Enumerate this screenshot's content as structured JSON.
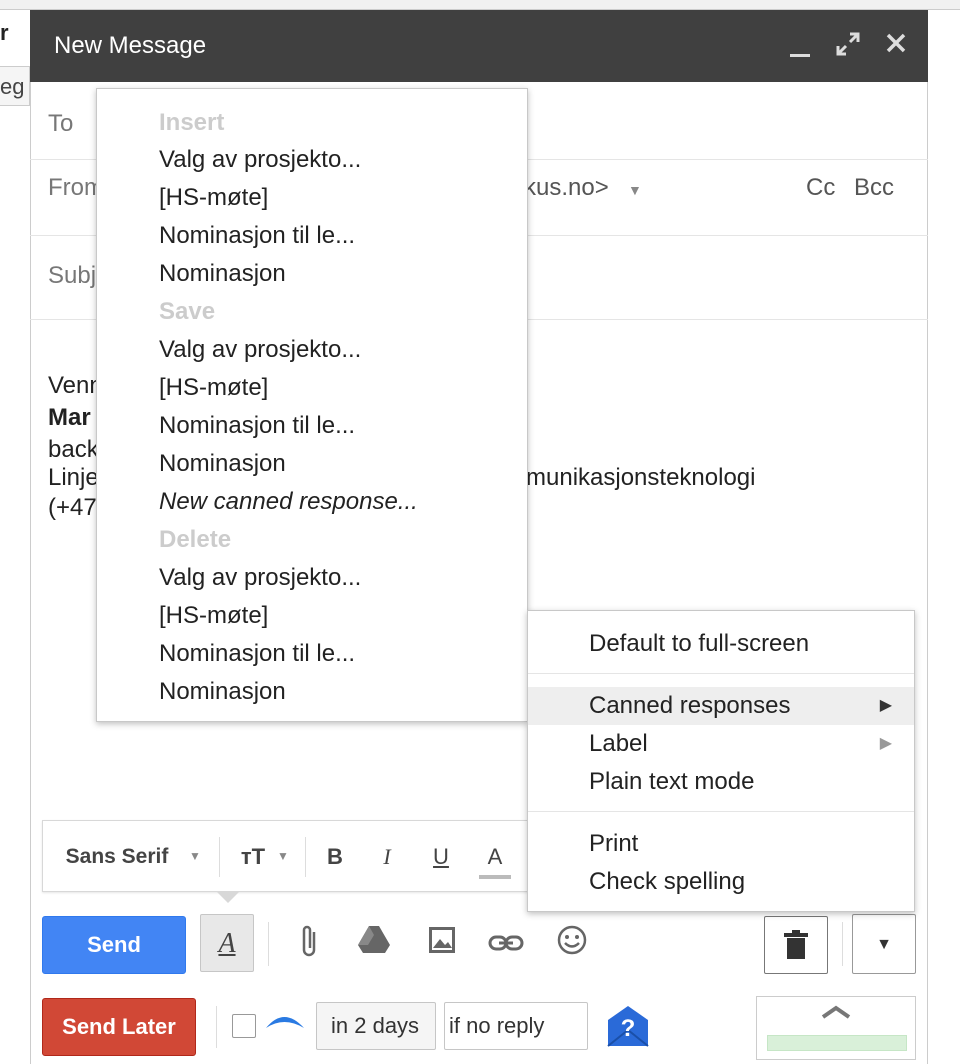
{
  "background": {
    "tab1": "r",
    "tab2": "eg"
  },
  "compose": {
    "title": "New Message",
    "to_label": "To",
    "from_label": "From",
    "from_value_suffix": "kus.no>",
    "cc": "Cc",
    "bcc": "Bcc",
    "subject_label": "Subject",
    "body_lines": [
      "Venn",
      "Mar",
      "back",
      "Linje",
      "(+47"
    ],
    "body_line_right": "munikasjonsteknologi"
  },
  "formatting": {
    "font": "Sans Serif",
    "bold": "B",
    "italic": "I",
    "underline": "U",
    "color": "A"
  },
  "bottom": {
    "send": "Send",
    "send_later": "Send Later",
    "delay": "in 2 days",
    "condition": "if no reply",
    "format_toggle": "A",
    "help": "?"
  },
  "canned_submenu": {
    "insert_header": "Insert",
    "insert_items": [
      "Valg av prosjekto...",
      "[HS-møte]",
      "Nominasjon til le...",
      "Nominasjon"
    ],
    "save_header": "Save",
    "save_items": [
      "Valg av prosjekto...",
      "[HS-møte]",
      "Nominasjon til le...",
      "Nominasjon"
    ],
    "new_response": "New canned response...",
    "delete_header": "Delete",
    "delete_items": [
      "Valg av prosjekto...",
      "[HS-møte]",
      "Nominasjon til le...",
      "Nominasjon"
    ]
  },
  "more_menu": {
    "full_screen": "Default to full-screen",
    "canned": "Canned responses",
    "label": "Label",
    "plain": "Plain text mode",
    "print": "Print",
    "spelling": "Check spelling"
  },
  "colors": {
    "titlebar": "#404040",
    "send": "#4285f4",
    "send_later": "#d14836",
    "help": "#2a6ad8"
  },
  "icons": [
    "minimize-icon",
    "expand-icon",
    "close-icon",
    "text-size-icon",
    "attach-icon",
    "drive-icon",
    "photo-icon",
    "link-icon",
    "emoji-icon",
    "trash-icon",
    "chevron-down-icon",
    "help-icon"
  ]
}
